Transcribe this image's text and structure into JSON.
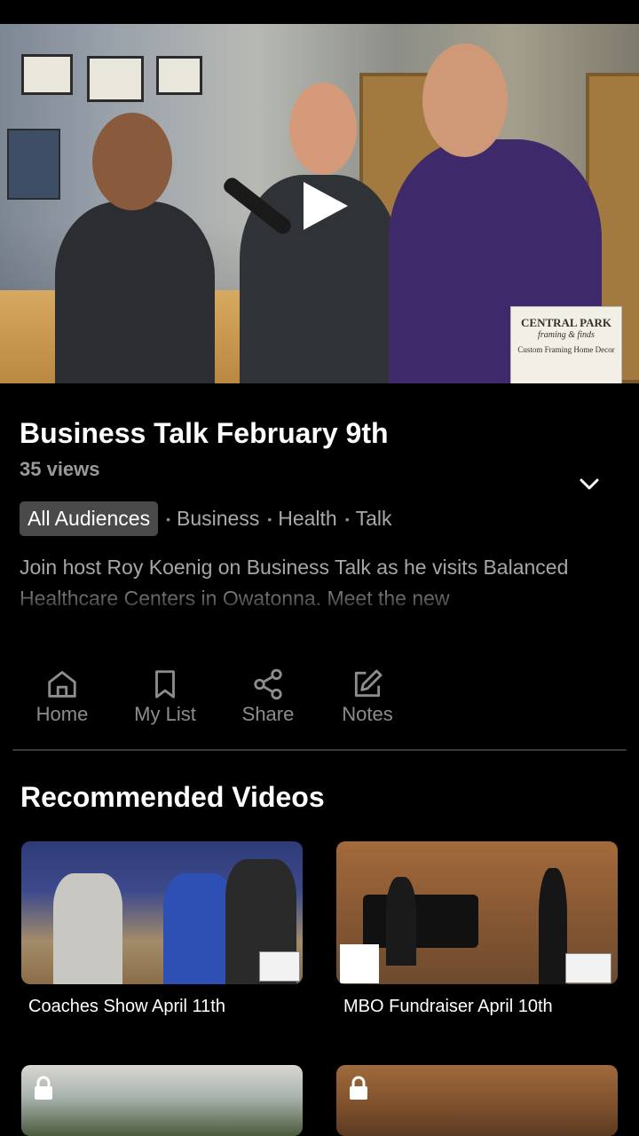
{
  "video": {
    "title": "Business Talk February 9th",
    "views": "35 views",
    "sponsor": {
      "name": "CENTRAL PARK",
      "tagline": "framing & finds",
      "sub": "Custom Framing  Home Decor"
    }
  },
  "tags": {
    "primary": "All Audiences",
    "others": [
      "Business",
      "Health",
      "Talk"
    ]
  },
  "description": "Join host Roy Koenig on Business Talk as he visits Balanced Healthcare Centers in Owatonna. Meet the new",
  "actions": [
    {
      "label": "Home",
      "icon": "home-icon"
    },
    {
      "label": "My List",
      "icon": "bookmark-icon"
    },
    {
      "label": "Share",
      "icon": "share-icon"
    },
    {
      "label": "Notes",
      "icon": "edit-icon"
    }
  ],
  "recommended": {
    "heading": "Recommended Videos",
    "items": [
      {
        "label": "Coaches Show  April 11th"
      },
      {
        "label": "MBO Fundraiser April 10th"
      }
    ]
  },
  "colors": {
    "background": "#000000",
    "pill": "#4a4a4a",
    "muted": "#9a9a9a"
  }
}
